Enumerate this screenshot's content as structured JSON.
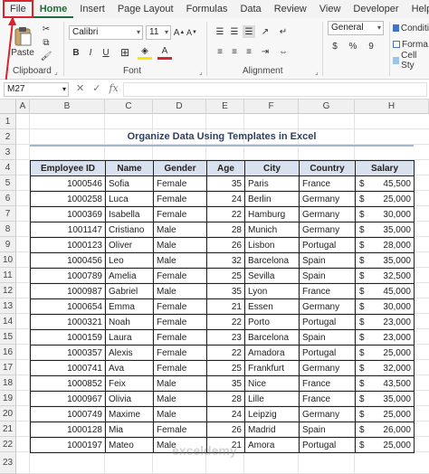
{
  "menu": [
    "File",
    "Home",
    "Insert",
    "Page Layout",
    "Formulas",
    "Data",
    "Review",
    "View",
    "Developer",
    "Help"
  ],
  "ribbon": {
    "clipboard": {
      "label": "Clipboard",
      "paste": "Paste"
    },
    "font": {
      "label": "Font",
      "name": "Calibri",
      "size": "11"
    },
    "alignment": {
      "label": "Alignment"
    },
    "number": {
      "format": "General",
      "dollar": "$",
      "percent": "%",
      "comma": "9"
    },
    "styles": [
      "Conditi",
      "Forma",
      "Cell Sty"
    ]
  },
  "formula_bar": {
    "cell_ref": "M27",
    "fx": "fx"
  },
  "columns": [
    "A",
    "B",
    "C",
    "D",
    "E",
    "F",
    "G",
    "H"
  ],
  "rows": [
    "1",
    "2",
    "3",
    "4",
    "5",
    "6",
    "7",
    "8",
    "9",
    "10",
    "11",
    "12",
    "13",
    "14",
    "15",
    "16",
    "17",
    "18",
    "19",
    "20",
    "21",
    "22",
    "23"
  ],
  "sheet_title": "Organize Data Using Templates in Excel",
  "table": {
    "headers": [
      "Employee ID",
      "Name",
      "Gender",
      "Age",
      "City",
      "Country",
      "Salary"
    ],
    "currency": "$",
    "rows": [
      [
        "1000546",
        "Sofia",
        "Female",
        "35",
        "Paris",
        "France",
        "45,500"
      ],
      [
        "1000258",
        "Luca",
        "Female",
        "24",
        "Berlin",
        "Germany",
        "25,000"
      ],
      [
        "1000369",
        "Isabella",
        "Female",
        "22",
        "Hamburg",
        "Germany",
        "30,000"
      ],
      [
        "1001147",
        "Cristiano",
        "Male",
        "28",
        "Munich",
        "Germany",
        "35,000"
      ],
      [
        "1000123",
        "Oliver",
        "Male",
        "26",
        "Lisbon",
        "Portugal",
        "28,000"
      ],
      [
        "1000456",
        "Leo",
        "Male",
        "32",
        "Barcelona",
        "Spain",
        "35,000"
      ],
      [
        "1000789",
        "Amelia",
        "Female",
        "25",
        "Sevilla",
        "Spain",
        "32,500"
      ],
      [
        "1000987",
        "Gabriel",
        "Male",
        "35",
        "Lyon",
        "France",
        "45,000"
      ],
      [
        "1000654",
        "Emma",
        "Female",
        "21",
        "Essen",
        "Germany",
        "30,000"
      ],
      [
        "1000321",
        "Noah",
        "Female",
        "22",
        "Porto",
        "Portugal",
        "23,000"
      ],
      [
        "1000159",
        "Laura",
        "Female",
        "23",
        "Barcelona",
        "Spain",
        "23,000"
      ],
      [
        "1000357",
        "Alexis",
        "Female",
        "22",
        "Amadora",
        "Portugal",
        "25,000"
      ],
      [
        "1000741",
        "Ava",
        "Female",
        "25",
        "Frankfurt",
        "Germany",
        "32,000"
      ],
      [
        "1000852",
        "Feix",
        "Male",
        "35",
        "Nice",
        "France",
        "43,500"
      ],
      [
        "1000967",
        "Olivia",
        "Male",
        "28",
        "Lille",
        "France",
        "35,000"
      ],
      [
        "1000749",
        "Maxime",
        "Male",
        "24",
        "Leipzig",
        "Germany",
        "25,000"
      ],
      [
        "1000128",
        "Mia",
        "Female",
        "26",
        "Madrid",
        "Spain",
        "26,000"
      ],
      [
        "1000197",
        "Mateo",
        "Male",
        "21",
        "Amora",
        "Portugal",
        "25,000"
      ]
    ]
  },
  "watermark": "exceldemy"
}
